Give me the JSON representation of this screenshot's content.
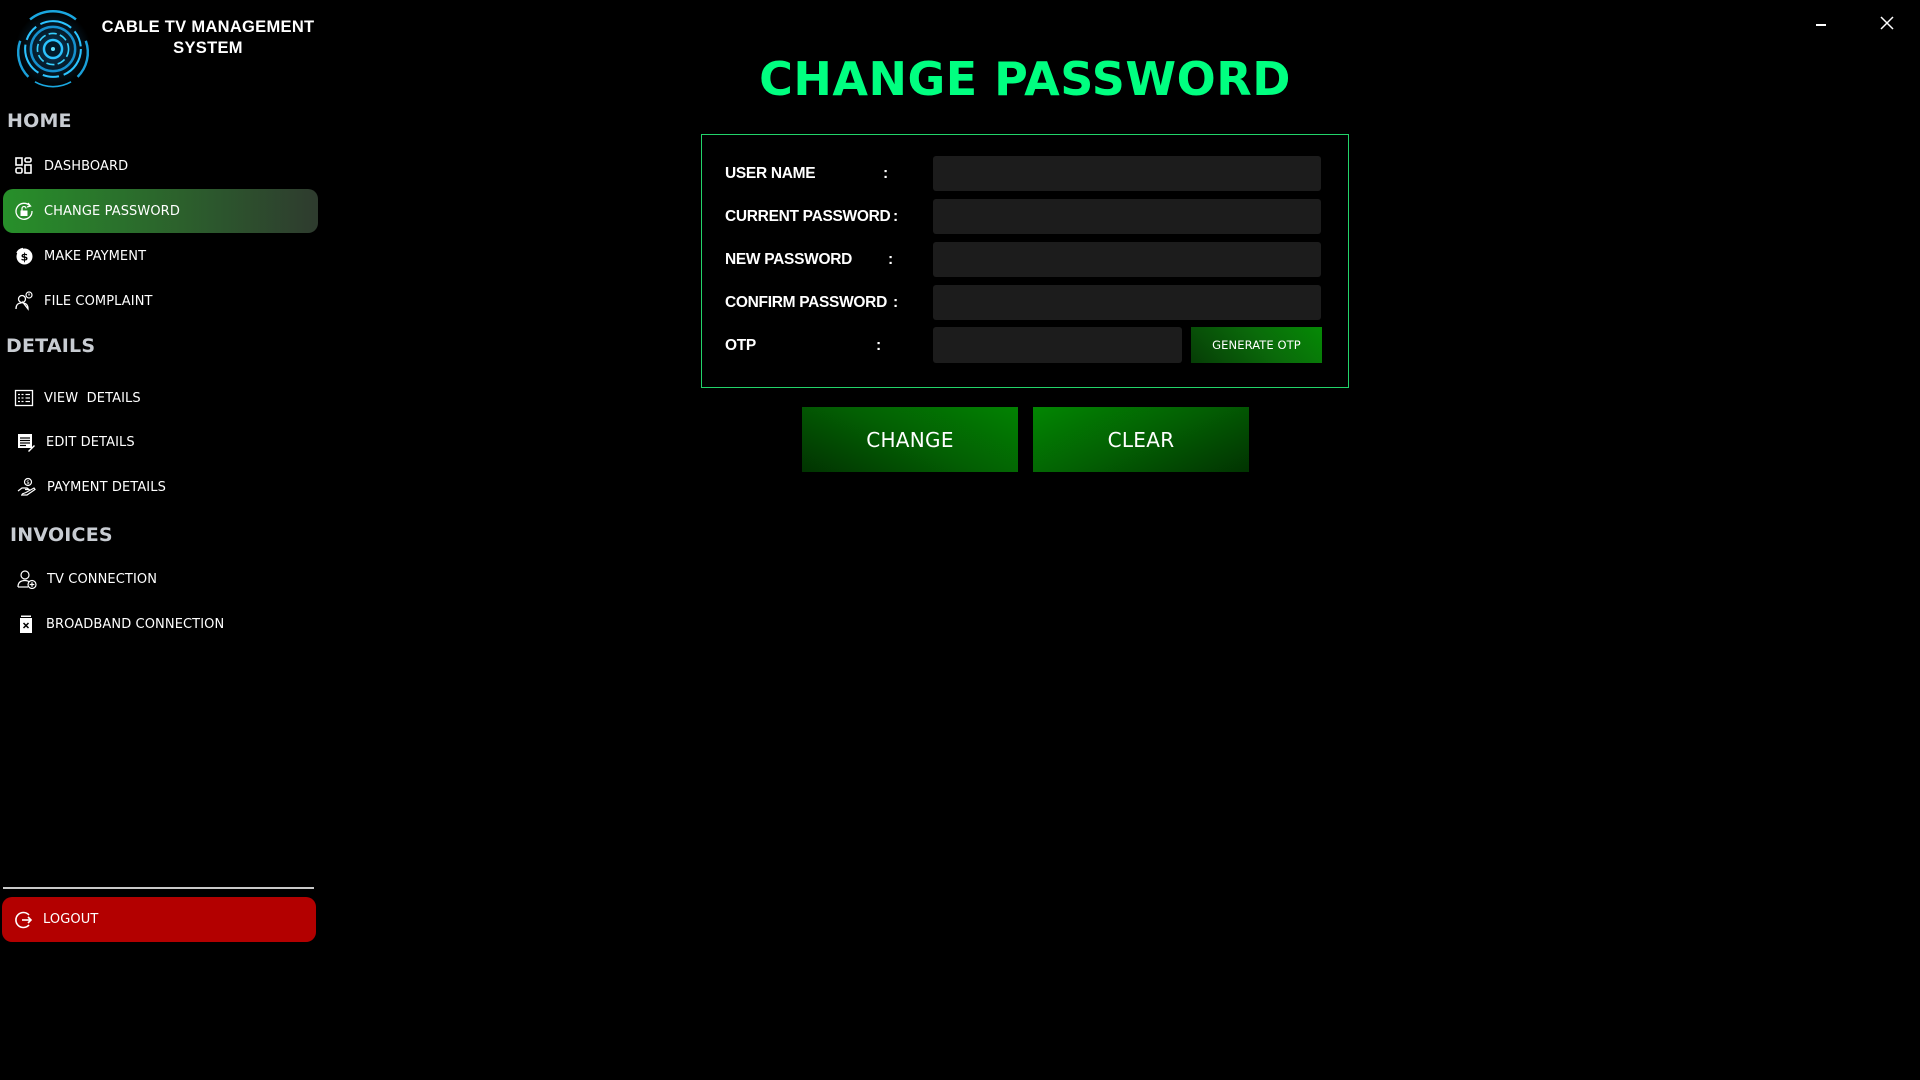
{
  "app": {
    "title_line1": "CABLE TV MANAGEMENT",
    "title_line2": "SYSTEM",
    "minimize_glyph": "",
    "close_glyph": "✕"
  },
  "sidebar": {
    "sections": [
      {
        "header": "HOME",
        "items": [
          {
            "label": "DASHBOARD",
            "icon": "dashboard-grid-icon",
            "active": false
          },
          {
            "label": "CHANGE PASSWORD",
            "icon": "unlock-refresh-icon",
            "active": true
          },
          {
            "label": "MAKE PAYMENT",
            "icon": "dollar-coin-icon",
            "active": false
          },
          {
            "label": "FILE COMPLAINT",
            "icon": "user-alert-icon",
            "active": false
          }
        ]
      },
      {
        "header": "DETAILS",
        "items": [
          {
            "label": "VIEW  DETAILS",
            "icon": "list-checklist-icon",
            "active": false
          },
          {
            "label": "EDIT DETAILS",
            "icon": "document-edit-icon",
            "active": false
          },
          {
            "label": "PAYMENT DETAILS",
            "icon": "hand-money-icon",
            "active": false
          }
        ]
      },
      {
        "header": "INVOICES",
        "items": [
          {
            "label": "TV CONNECTION",
            "icon": "user-add-icon",
            "active": false
          },
          {
            "label": "BROADBAND CONNECTION",
            "icon": "delete-bin-icon",
            "active": false
          }
        ]
      }
    ],
    "logout_label": "LOGOUT"
  },
  "main": {
    "title": "CHANGE PASSWORD",
    "fields": [
      {
        "label": "USER NAME",
        "value": "",
        "placeholder": ""
      },
      {
        "label": "CURRENT PASSWORD",
        "value": "",
        "placeholder": ""
      },
      {
        "label": "NEW PASSWORD",
        "value": "",
        "placeholder": ""
      },
      {
        "label": "CONFIRM PASSWORD",
        "value": "",
        "placeholder": ""
      },
      {
        "label": "OTP",
        "value": "",
        "placeholder": ""
      }
    ],
    "colon": ":",
    "generate_otp_label": "GENERATE OTP",
    "change_label": "CHANGE",
    "clear_label": "CLEAR"
  },
  "colors": {
    "accent_title": "#00ff80",
    "active_nav": "#27902a",
    "logout": "#b30000",
    "form_border": "#22d36a",
    "input_bg": "#1c1c1c"
  }
}
